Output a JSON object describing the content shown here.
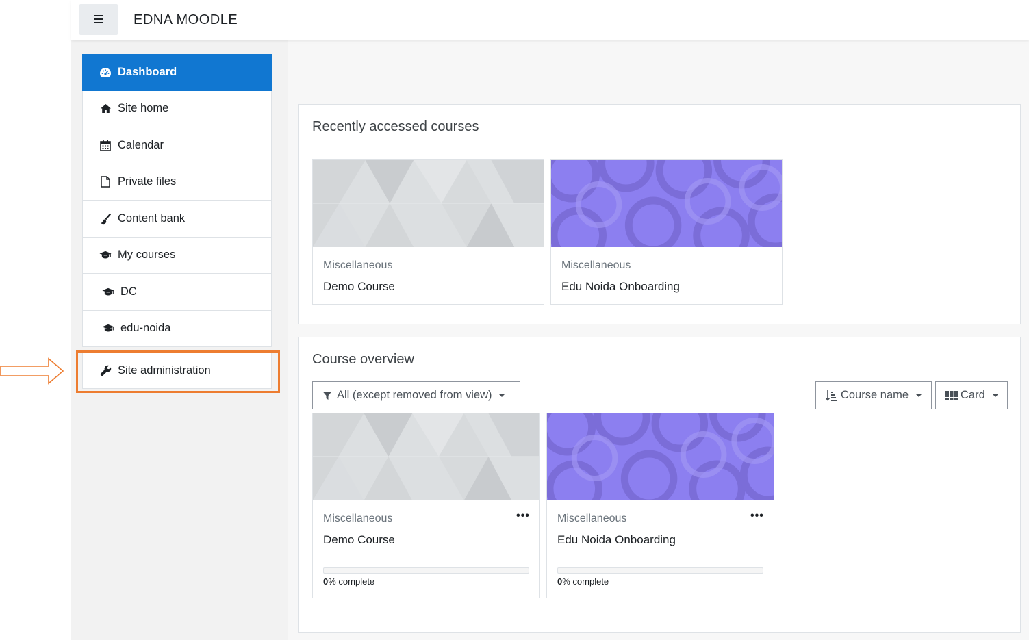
{
  "header": {
    "site_name": "EDNA MOODLE",
    "menu_icon": "hamburger-icon"
  },
  "nav": {
    "items": [
      {
        "label": "Dashboard",
        "icon": "tachometer-icon",
        "active": true
      },
      {
        "label": "Site home",
        "icon": "home-icon"
      },
      {
        "label": "Calendar",
        "icon": "calendar-icon"
      },
      {
        "label": "Private files",
        "icon": "file-icon"
      },
      {
        "label": "Content bank",
        "icon": "paintbrush-icon"
      },
      {
        "label": "My courses",
        "icon": "graduation-cap-icon"
      },
      {
        "label": "DC",
        "icon": "graduation-cap-icon"
      },
      {
        "label": "edu-noida",
        "icon": "graduation-cap-icon"
      }
    ],
    "admin": {
      "label": "Site administration",
      "icon": "wrench-icon"
    }
  },
  "recent": {
    "title": "Recently accessed courses",
    "courses": [
      {
        "category": "Miscellaneous",
        "name": "Demo Course"
      },
      {
        "category": "Miscellaneous",
        "name": "Edu Noida Onboarding"
      }
    ]
  },
  "overview": {
    "title": "Course overview",
    "filter_label": "All (except removed from view)",
    "sort_label": "Course name",
    "view_label": "Card",
    "courses": [
      {
        "category": "Miscellaneous",
        "name": "Demo Course",
        "progress": "0",
        "progress_suffix": "% complete"
      },
      {
        "category": "Miscellaneous",
        "name": "Edu Noida Onboarding",
        "progress": "0",
        "progress_suffix": "% complete"
      }
    ]
  },
  "colors": {
    "accent": "#1177d1",
    "highlight": "#ed7d31",
    "course_purple": "#8c7ff0",
    "course_grey": "#d7d9db"
  }
}
